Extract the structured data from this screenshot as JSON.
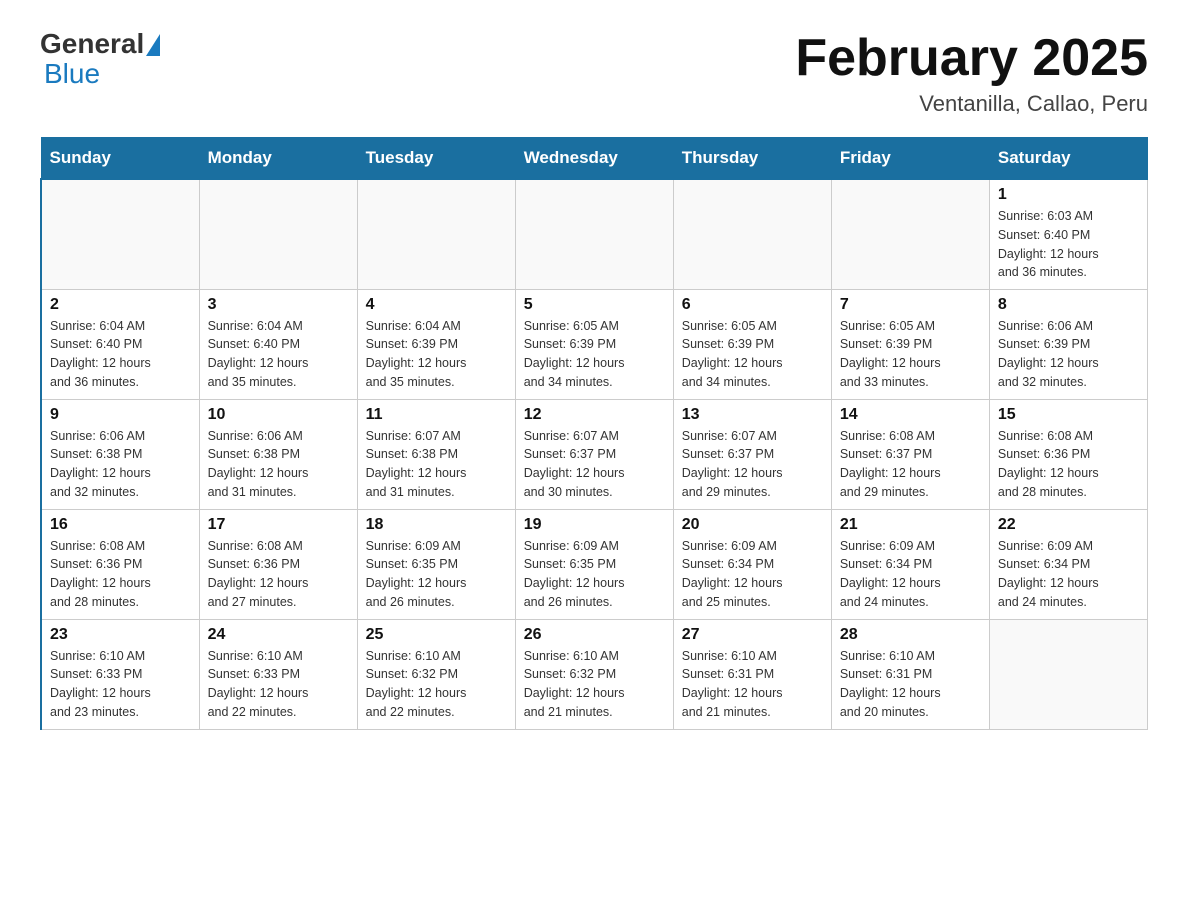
{
  "header": {
    "logo_general": "General",
    "logo_blue": "Blue",
    "month_title": "February 2025",
    "location": "Ventanilla, Callao, Peru"
  },
  "days_of_week": [
    "Sunday",
    "Monday",
    "Tuesday",
    "Wednesday",
    "Thursday",
    "Friday",
    "Saturday"
  ],
  "weeks": [
    [
      {
        "day": "",
        "info": ""
      },
      {
        "day": "",
        "info": ""
      },
      {
        "day": "",
        "info": ""
      },
      {
        "day": "",
        "info": ""
      },
      {
        "day": "",
        "info": ""
      },
      {
        "day": "",
        "info": ""
      },
      {
        "day": "1",
        "info": "Sunrise: 6:03 AM\nSunset: 6:40 PM\nDaylight: 12 hours\nand 36 minutes."
      }
    ],
    [
      {
        "day": "2",
        "info": "Sunrise: 6:04 AM\nSunset: 6:40 PM\nDaylight: 12 hours\nand 36 minutes."
      },
      {
        "day": "3",
        "info": "Sunrise: 6:04 AM\nSunset: 6:40 PM\nDaylight: 12 hours\nand 35 minutes."
      },
      {
        "day": "4",
        "info": "Sunrise: 6:04 AM\nSunset: 6:39 PM\nDaylight: 12 hours\nand 35 minutes."
      },
      {
        "day": "5",
        "info": "Sunrise: 6:05 AM\nSunset: 6:39 PM\nDaylight: 12 hours\nand 34 minutes."
      },
      {
        "day": "6",
        "info": "Sunrise: 6:05 AM\nSunset: 6:39 PM\nDaylight: 12 hours\nand 34 minutes."
      },
      {
        "day": "7",
        "info": "Sunrise: 6:05 AM\nSunset: 6:39 PM\nDaylight: 12 hours\nand 33 minutes."
      },
      {
        "day": "8",
        "info": "Sunrise: 6:06 AM\nSunset: 6:39 PM\nDaylight: 12 hours\nand 32 minutes."
      }
    ],
    [
      {
        "day": "9",
        "info": "Sunrise: 6:06 AM\nSunset: 6:38 PM\nDaylight: 12 hours\nand 32 minutes."
      },
      {
        "day": "10",
        "info": "Sunrise: 6:06 AM\nSunset: 6:38 PM\nDaylight: 12 hours\nand 31 minutes."
      },
      {
        "day": "11",
        "info": "Sunrise: 6:07 AM\nSunset: 6:38 PM\nDaylight: 12 hours\nand 31 minutes."
      },
      {
        "day": "12",
        "info": "Sunrise: 6:07 AM\nSunset: 6:37 PM\nDaylight: 12 hours\nand 30 minutes."
      },
      {
        "day": "13",
        "info": "Sunrise: 6:07 AM\nSunset: 6:37 PM\nDaylight: 12 hours\nand 29 minutes."
      },
      {
        "day": "14",
        "info": "Sunrise: 6:08 AM\nSunset: 6:37 PM\nDaylight: 12 hours\nand 29 minutes."
      },
      {
        "day": "15",
        "info": "Sunrise: 6:08 AM\nSunset: 6:36 PM\nDaylight: 12 hours\nand 28 minutes."
      }
    ],
    [
      {
        "day": "16",
        "info": "Sunrise: 6:08 AM\nSunset: 6:36 PM\nDaylight: 12 hours\nand 28 minutes."
      },
      {
        "day": "17",
        "info": "Sunrise: 6:08 AM\nSunset: 6:36 PM\nDaylight: 12 hours\nand 27 minutes."
      },
      {
        "day": "18",
        "info": "Sunrise: 6:09 AM\nSunset: 6:35 PM\nDaylight: 12 hours\nand 26 minutes."
      },
      {
        "day": "19",
        "info": "Sunrise: 6:09 AM\nSunset: 6:35 PM\nDaylight: 12 hours\nand 26 minutes."
      },
      {
        "day": "20",
        "info": "Sunrise: 6:09 AM\nSunset: 6:34 PM\nDaylight: 12 hours\nand 25 minutes."
      },
      {
        "day": "21",
        "info": "Sunrise: 6:09 AM\nSunset: 6:34 PM\nDaylight: 12 hours\nand 24 minutes."
      },
      {
        "day": "22",
        "info": "Sunrise: 6:09 AM\nSunset: 6:34 PM\nDaylight: 12 hours\nand 24 minutes."
      }
    ],
    [
      {
        "day": "23",
        "info": "Sunrise: 6:10 AM\nSunset: 6:33 PM\nDaylight: 12 hours\nand 23 minutes."
      },
      {
        "day": "24",
        "info": "Sunrise: 6:10 AM\nSunset: 6:33 PM\nDaylight: 12 hours\nand 22 minutes."
      },
      {
        "day": "25",
        "info": "Sunrise: 6:10 AM\nSunset: 6:32 PM\nDaylight: 12 hours\nand 22 minutes."
      },
      {
        "day": "26",
        "info": "Sunrise: 6:10 AM\nSunset: 6:32 PM\nDaylight: 12 hours\nand 21 minutes."
      },
      {
        "day": "27",
        "info": "Sunrise: 6:10 AM\nSunset: 6:31 PM\nDaylight: 12 hours\nand 21 minutes."
      },
      {
        "day": "28",
        "info": "Sunrise: 6:10 AM\nSunset: 6:31 PM\nDaylight: 12 hours\nand 20 minutes."
      },
      {
        "day": "",
        "info": ""
      }
    ]
  ]
}
